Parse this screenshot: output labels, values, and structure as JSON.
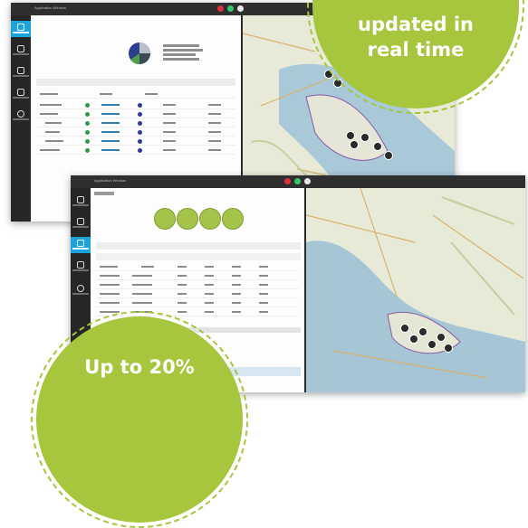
{
  "app": {
    "title": "Application Window"
  },
  "badges": {
    "top_lines": [
      "updated in",
      "real time"
    ],
    "bottom_line": "Up to 20%"
  },
  "colors": {
    "accent_green": "#a5c63d",
    "sidebar_active": "#1aa3dd",
    "window_dark": "#2b2b2b",
    "status_red": "#e0303a",
    "status_green": "#39c76b"
  },
  "icons": [
    "map-pin-icon",
    "gear-icon",
    "home-icon",
    "list-icon",
    "chart-icon"
  ]
}
